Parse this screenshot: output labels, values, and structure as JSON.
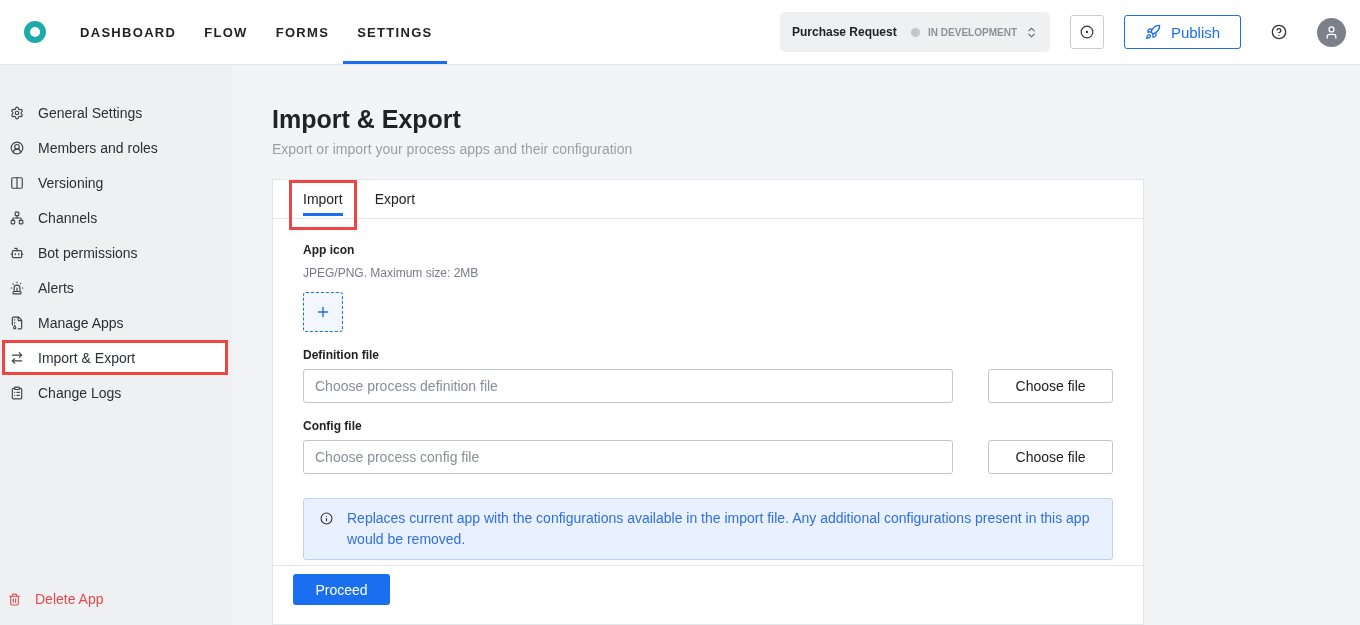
{
  "nav": {
    "items": [
      {
        "label": "DASHBOARD",
        "selected": false
      },
      {
        "label": "FLOW",
        "selected": false
      },
      {
        "label": "FORMS",
        "selected": false
      },
      {
        "label": "SETTINGS",
        "selected": true
      }
    ]
  },
  "app_switcher": {
    "name": "Purchase Request",
    "status": "IN DEVELOPMENT"
  },
  "publish_button": "Publish",
  "sidebar": {
    "items": [
      {
        "label": "General Settings",
        "selected": false,
        "highlighted": false
      },
      {
        "label": "Members and roles",
        "selected": false,
        "highlighted": false
      },
      {
        "label": "Versioning",
        "selected": false,
        "highlighted": false
      },
      {
        "label": "Channels",
        "selected": false,
        "highlighted": false
      },
      {
        "label": "Bot permissions",
        "selected": false,
        "highlighted": false
      },
      {
        "label": "Alerts",
        "selected": false,
        "highlighted": false
      },
      {
        "label": "Manage Apps",
        "selected": false,
        "highlighted": false
      },
      {
        "label": "Import & Export",
        "selected": true,
        "highlighted": true
      },
      {
        "label": "Change Logs",
        "selected": false,
        "highlighted": false
      }
    ],
    "delete": "Delete App"
  },
  "page": {
    "title": "Import & Export",
    "subtitle": "Export or import your process apps and their configuration"
  },
  "tabs": [
    {
      "label": "Import",
      "selected": true,
      "highlighted": true
    },
    {
      "label": "Export",
      "selected": false,
      "highlighted": false
    }
  ],
  "app_icon": {
    "label": "App icon",
    "hint": "JPEG/PNG. Maximum size: 2MB"
  },
  "files": [
    {
      "label": "Definition file",
      "placeholder": "Choose process definition file",
      "button": "Choose file"
    },
    {
      "label": "Config file",
      "placeholder": "Choose process config file",
      "button": "Choose file"
    }
  ],
  "notice": "Replaces current app with the configurations available in the import file. Any additional configurations present in this app would be removed.",
  "proceed_button": "Proceed"
}
